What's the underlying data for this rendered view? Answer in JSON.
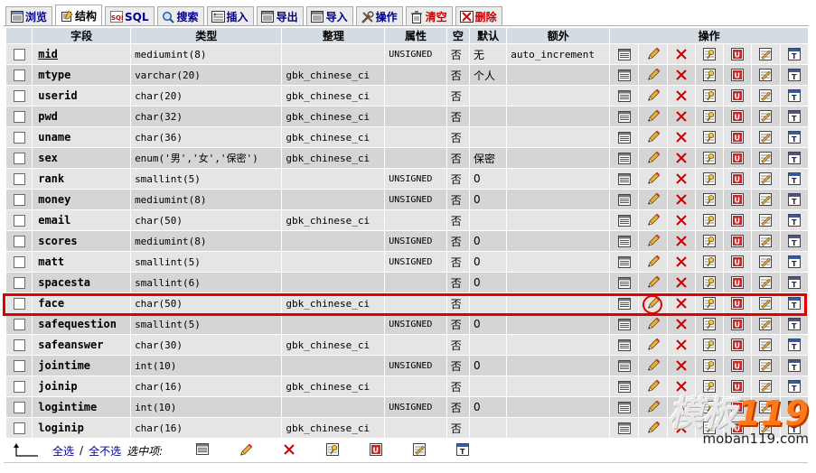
{
  "tabs": [
    {
      "label": "浏览",
      "icon": "browse-icon"
    },
    {
      "label": "结构",
      "icon": "structure-icon",
      "active": true
    },
    {
      "label": "SQL",
      "icon": "sql-icon"
    },
    {
      "label": "搜索",
      "icon": "search-icon"
    },
    {
      "label": "插入",
      "icon": "insert-icon"
    },
    {
      "label": "导出",
      "icon": "export-icon"
    },
    {
      "label": "导入",
      "icon": "import-icon"
    },
    {
      "label": "操作",
      "icon": "operations-icon"
    },
    {
      "label": "清空",
      "icon": "empty-icon",
      "danger": true
    },
    {
      "label": "删除",
      "icon": "drop-icon",
      "danger": true
    }
  ],
  "table": {
    "headers": {
      "field": "字段",
      "type": "类型",
      "collation": "整理",
      "attributes": "属性",
      "null": "空",
      "default": "默认",
      "extra": "额外",
      "action": "操作"
    },
    "rows": [
      {
        "field": "mid",
        "type": "mediumint(8)",
        "collation": "",
        "attributes": "UNSIGNED",
        "null": "否",
        "default": "无",
        "extra": "auto_increment",
        "primary": true
      },
      {
        "field": "mtype",
        "type": "varchar(20)",
        "collation": "gbk_chinese_ci",
        "attributes": "",
        "null": "否",
        "default": "个人",
        "extra": ""
      },
      {
        "field": "userid",
        "type": "char(20)",
        "collation": "gbk_chinese_ci",
        "attributes": "",
        "null": "否",
        "default": "",
        "extra": ""
      },
      {
        "field": "pwd",
        "type": "char(32)",
        "collation": "gbk_chinese_ci",
        "attributes": "",
        "null": "否",
        "default": "",
        "extra": ""
      },
      {
        "field": "uname",
        "type": "char(36)",
        "collation": "gbk_chinese_ci",
        "attributes": "",
        "null": "否",
        "default": "",
        "extra": ""
      },
      {
        "field": "sex",
        "type": "enum('男','女','保密')",
        "collation": "gbk_chinese_ci",
        "attributes": "",
        "null": "否",
        "default": "保密",
        "extra": ""
      },
      {
        "field": "rank",
        "type": "smallint(5)",
        "collation": "",
        "attributes": "UNSIGNED",
        "null": "否",
        "default": "0",
        "extra": ""
      },
      {
        "field": "money",
        "type": "mediumint(8)",
        "collation": "",
        "attributes": "UNSIGNED",
        "null": "否",
        "default": "0",
        "extra": ""
      },
      {
        "field": "email",
        "type": "char(50)",
        "collation": "gbk_chinese_ci",
        "attributes": "",
        "null": "否",
        "default": "",
        "extra": ""
      },
      {
        "field": "scores",
        "type": "mediumint(8)",
        "collation": "",
        "attributes": "UNSIGNED",
        "null": "否",
        "default": "0",
        "extra": ""
      },
      {
        "field": "matt",
        "type": "smallint(5)",
        "collation": "",
        "attributes": "UNSIGNED",
        "null": "否",
        "default": "0",
        "extra": ""
      },
      {
        "field": "spacesta",
        "type": "smallint(6)",
        "collation": "",
        "attributes": "",
        "null": "否",
        "default": "0",
        "extra": ""
      },
      {
        "field": "face",
        "type": "char(50)",
        "collation": "gbk_chinese_ci",
        "attributes": "",
        "null": "否",
        "default": "",
        "extra": "",
        "highlighted": true
      },
      {
        "field": "safequestion",
        "type": "smallint(5)",
        "collation": "",
        "attributes": "UNSIGNED",
        "null": "否",
        "default": "0",
        "extra": ""
      },
      {
        "field": "safeanswer",
        "type": "char(30)",
        "collation": "gbk_chinese_ci",
        "attributes": "",
        "null": "否",
        "default": "",
        "extra": ""
      },
      {
        "field": "jointime",
        "type": "int(10)",
        "collation": "",
        "attributes": "UNSIGNED",
        "null": "否",
        "default": "0",
        "extra": ""
      },
      {
        "field": "joinip",
        "type": "char(16)",
        "collation": "gbk_chinese_ci",
        "attributes": "",
        "null": "否",
        "default": "",
        "extra": ""
      },
      {
        "field": "logintime",
        "type": "int(10)",
        "collation": "",
        "attributes": "UNSIGNED",
        "null": "否",
        "default": "0",
        "extra": ""
      },
      {
        "field": "loginip",
        "type": "char(16)",
        "collation": "gbk_chinese_ci",
        "attributes": "",
        "null": "否",
        "default": "",
        "extra": ""
      }
    ],
    "row_actions": [
      "browse-distinct-icon",
      "edit-pencil-icon",
      "drop-x-icon",
      "primary-key-icon",
      "unique-icon",
      "index-icon",
      "fulltext-icon"
    ]
  },
  "footer": {
    "check_all": "全选",
    "separator": "/",
    "uncheck_all": "全不选",
    "with_selected": "选中项:",
    "actions": [
      "browse-distinct-icon",
      "edit-pencil-icon",
      "drop-x-icon",
      "primary-key-icon",
      "unique-icon",
      "index-icon",
      "fulltext-icon"
    ]
  },
  "watermark": {
    "logo_text": "模板",
    "logo_number": "119",
    "url": "moban119.com"
  },
  "colors": {
    "header_bg": "#d3dce3",
    "row_odd": "#e5e5e5",
    "row_even": "#d5d5d5",
    "highlight": "#e00000",
    "link": "#00008b"
  }
}
